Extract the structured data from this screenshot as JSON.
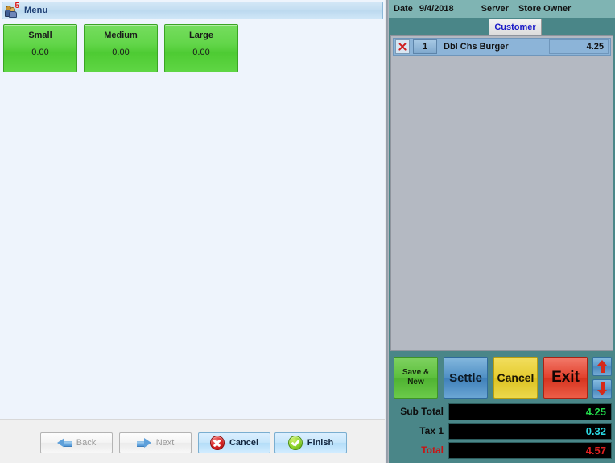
{
  "window": {
    "title": "Menu",
    "icon": "users-icon",
    "icon_badge": "5"
  },
  "menu": {
    "size_buttons": [
      {
        "label": "Small",
        "price": "0.00"
      },
      {
        "label": "Medium",
        "price": "0.00"
      },
      {
        "label": "Large",
        "price": "0.00"
      }
    ]
  },
  "wizard": {
    "back": {
      "label": "Back",
      "icon": "arrow-left-icon",
      "enabled": false
    },
    "next": {
      "label": "Next",
      "icon": "arrow-right-icon",
      "enabled": false
    },
    "cancel": {
      "label": "Cancel",
      "icon": "cancel-circle-icon",
      "enabled": true
    },
    "finish": {
      "label": "Finish",
      "icon": "check-circle-icon",
      "enabled": true
    }
  },
  "order": {
    "header": {
      "date_label": "Date",
      "date_value": "9/4/2018",
      "server_label": "Server",
      "server_value": "Store Owner"
    },
    "tabs": [
      {
        "label": "Customer",
        "active": true
      }
    ],
    "items": [
      {
        "delete_icon": "red-x-icon",
        "quantity": "1",
        "name": "Dbl Chs Burger",
        "price": "4.25"
      }
    ]
  },
  "actions": {
    "save_new": "Save &\nNew",
    "save_new_line1": "Save &",
    "save_new_line2": "New",
    "settle": "Settle",
    "cancel": "Cancel",
    "exit": "Exit",
    "scroll_up_icon": "arrow-up-icon",
    "scroll_down_icon": "arrow-down-icon"
  },
  "totals": [
    {
      "label": "Sub Total",
      "value": "4.25",
      "value_color": "#22d94a",
      "label_color": "#0d0d0d"
    },
    {
      "label": "Tax 1",
      "value": "0.32",
      "value_color": "#2ad8e2",
      "label_color": "#0d0d0d"
    },
    {
      "label": "Total",
      "value": "4.57",
      "value_color": "#e02020",
      "label_color": "#c81414"
    }
  ],
  "colors": {
    "left_bg": "#eef4fc",
    "teal_panel": "#4a8688",
    "teal_header": "#7fb4b3",
    "order_list_bg": "#b4b9c2",
    "row_blue": "#8cb4d8",
    "green_button": "#4ecb33"
  }
}
